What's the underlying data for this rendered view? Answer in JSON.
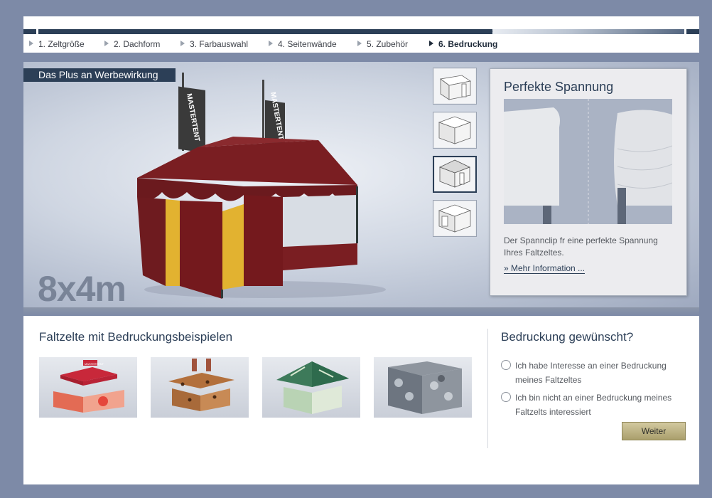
{
  "steps": [
    {
      "label": "1. Zeltgröße",
      "active": false
    },
    {
      "label": "2. Dachform",
      "active": false
    },
    {
      "label": "3. Farbauswahl",
      "active": false
    },
    {
      "label": "4. Seitenwände",
      "active": false
    },
    {
      "label": "5. Zubehör",
      "active": false
    },
    {
      "label": "6. Bedruckung",
      "active": true
    }
  ],
  "hero": {
    "label": "Das Plus an Werbewirkung",
    "size": "8x4m",
    "flag_text": "MASTERTENT",
    "tent_color": "#7a1e22"
  },
  "info": {
    "title": "Perfekte Spannung",
    "text": "Der Spannclip fr eine perfekte Spannung Ihres Faltzeltes.",
    "link": "» Mehr Information ..."
  },
  "examples": {
    "title": "Faltzelte mit Bedruckungsbeispielen",
    "items": [
      {
        "name": "example-red-tent",
        "text": "MASTERTENT"
      },
      {
        "name": "example-leopard-tent"
      },
      {
        "name": "example-green-tent"
      },
      {
        "name": "example-stone-tent"
      }
    ]
  },
  "printing": {
    "title": "Bedruckung gewünscht?",
    "options": [
      "Ich habe Interesse an einer Bedruckung meines Faltzeltes",
      "Ich bin nicht an einer Bedruckung meines Faltzelts interessiert"
    ],
    "button": "Weiter"
  },
  "colors": {
    "navy": "#2c3f57",
    "background": "#7d8aa7",
    "button_gold": "#c0b586"
  }
}
